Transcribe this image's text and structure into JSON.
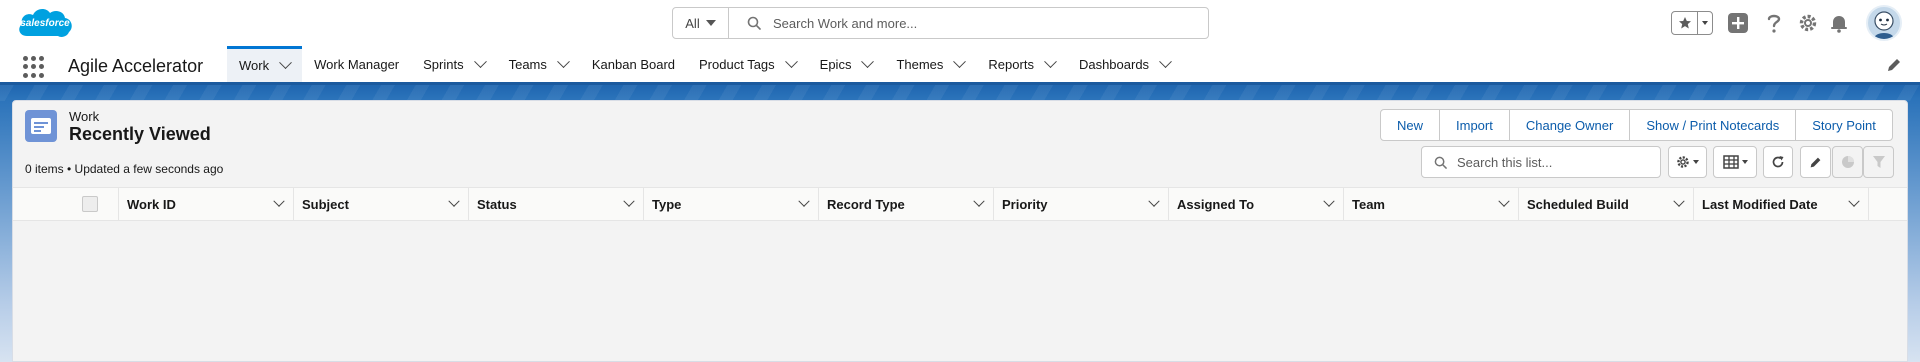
{
  "header": {
    "logo_text": "salesforce",
    "search": {
      "scope": "All",
      "placeholder": "Search Work and more..."
    }
  },
  "nav": {
    "app_name": "Agile Accelerator",
    "items": [
      {
        "label": "Work",
        "dropdown": true,
        "active": true
      },
      {
        "label": "Work Manager",
        "dropdown": false
      },
      {
        "label": "Sprints",
        "dropdown": true
      },
      {
        "label": "Teams",
        "dropdown": true
      },
      {
        "label": "Kanban Board",
        "dropdown": false
      },
      {
        "label": "Product Tags",
        "dropdown": true
      },
      {
        "label": "Epics",
        "dropdown": true
      },
      {
        "label": "Themes",
        "dropdown": true
      },
      {
        "label": "Reports",
        "dropdown": true
      },
      {
        "label": "Dashboards",
        "dropdown": true
      }
    ]
  },
  "list_view": {
    "object_label": "Work",
    "title": "Recently Viewed",
    "meta": "0 items • Updated a few seconds ago",
    "buttons": [
      "New",
      "Import",
      "Change Owner",
      "Show / Print Notecards",
      "Story Point"
    ],
    "search_placeholder": "Search this list...",
    "columns": [
      "Work ID",
      "Subject",
      "Status",
      "Type",
      "Record Type",
      "Priority",
      "Assigned To",
      "Team",
      "Scheduled Build",
      "Last Modified Date"
    ]
  },
  "colors": {
    "brand": "#0176d3",
    "link": "#0b5cab",
    "nav_border": "#1b5a9e",
    "object_icon": "#6f93d6"
  }
}
